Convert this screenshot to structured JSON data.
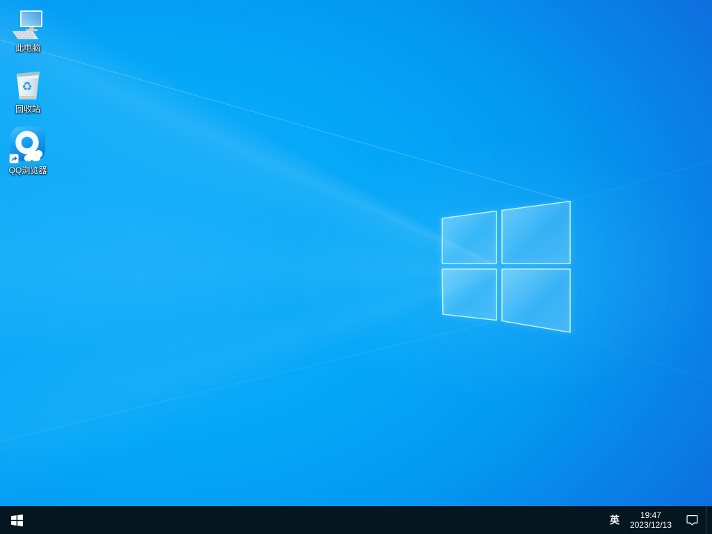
{
  "desktop": {
    "icons": [
      {
        "id": "this-pc",
        "label": "此电脑",
        "icon": "computer-monitor-icon"
      },
      {
        "id": "recycle-bin",
        "label": "回收站",
        "icon": "recycle-bin-icon"
      },
      {
        "id": "qq-browser",
        "label": "QQ浏览器",
        "icon": "qq-browser-icon",
        "shortcut_overlay": "shortcut-arrow-icon"
      }
    ],
    "wallpaper": "windows-10-light-ray-wallpaper",
    "wallpaper_logo": "windows-flag-logo"
  },
  "taskbar": {
    "start_icon": "windows-start-icon",
    "ime_indicator": "英",
    "clock": {
      "time": "19:47",
      "date": "2023/12/13"
    },
    "action_center_icon": "action-center-icon",
    "show_desktop_strip": "show-desktop-button"
  },
  "colors": {
    "wallpaper_bright_blue": "#04a7f8",
    "wallpaper_deep_blue": "#1347c6",
    "logo_edge_cyan": "#bdf4ff",
    "taskbar_dark": "#04161f",
    "recycle_symbol_blue": "#2f96dd",
    "qq_tile_blue": "#0f8ce4"
  }
}
